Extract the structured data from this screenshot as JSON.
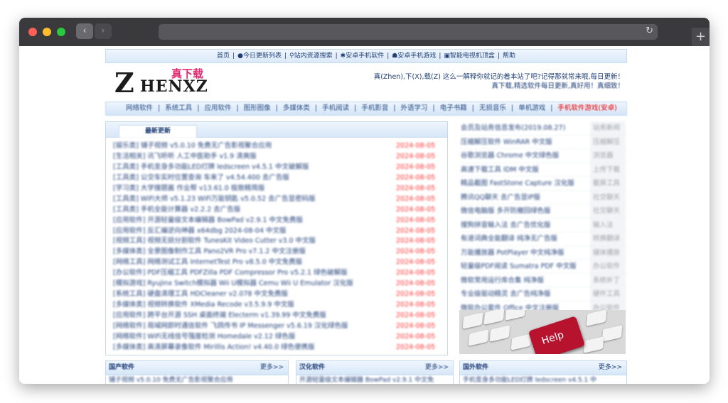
{
  "browser": {
    "back_icon": "chevron-left",
    "forward_icon": "chevron-right",
    "reload_icon": "reload",
    "new_tab_icon": "plus",
    "reload_glyph": "↻",
    "new_tab_glyph": "+",
    "back_glyph": "‹",
    "forward_glyph": "›"
  },
  "topnav": {
    "items": [
      "首页",
      "|",
      "●今日更新列表",
      "|",
      "⚲站内资源搜索",
      "|",
      "✱安卓手机软件",
      "|",
      "☗安卓手机游戏",
      "|",
      "▣智能电视机顶盒",
      "|",
      "帮助"
    ]
  },
  "logo": {
    "z": "Z",
    "rest": "HENXZ",
    "cn": "真下载"
  },
  "slogan": {
    "line1": "真(Zhen),下(X),载(Z) 这么一解释你就记的着本站了吧?记得那就常来哦,每日更新！",
    "line2": "真下载,精选软件每日更新,真好用！真细致！"
  },
  "catbar": {
    "items": [
      "网络软件",
      "|",
      "系统工具",
      "|",
      "应用软件",
      "|",
      "图形图像",
      "|",
      "多媒体类",
      "|",
      "手机阅读",
      "|",
      "手机影音",
      "|",
      "外语学习",
      "|",
      "电子书籍",
      "|",
      "无损音乐",
      "|",
      "单机游戏",
      "|"
    ],
    "highlight": "手机软件游戏(安卓)"
  },
  "updates": {
    "tab_label": "最新更新",
    "rows": [
      {
        "title": "[娱乐类] 铺子视频 v5.0.10 免费无广告影视聚合应用",
        "date": "2024-08-05"
      },
      {
        "title": "[生活相关] 讯飞听听 人工中医助手 v1.9 清爽版",
        "date": "2024-08-05"
      },
      {
        "title": "[工具类] 手机变身多功能LED灯牌 ledscreen v4.5.1 中文破解版",
        "date": "2024-08-05"
      },
      {
        "title": "[工具类] 公交车实时位置查询 车来了 v4.54.400 去广告版",
        "date": "2024-08-05"
      },
      {
        "title": "[学习类] 大学搜题酱 作业帮 v13.61.0 极致精简版",
        "date": "2024-08-05"
      },
      {
        "title": "[工具类] WiFi大师 v5.1.23 WiFi万能钥匙 v5.0.52 去广告显密码版",
        "date": "2024-08-05"
      },
      {
        "title": "[工具类] 手机全能计算器 v2.2.2 去广告版",
        "date": "2024-08-05"
      },
      {
        "title": "[应用软件] 开源轻量级文本编辑器 BowPad v2.9.1 中文免费版",
        "date": "2024-08-05"
      },
      {
        "title": "[应用软件] 反汇编逆向神器 x64dbg 2024-08-04 中文版",
        "date": "2024-08-05"
      },
      {
        "title": "[视频工具] 视频无损分割软件 TunesKit Video Cutter v3.0 中文版",
        "date": "2024-08-05"
      },
      {
        "title": "[多媒体类] 全景图像制作工具 Pano2VR Pro v7.1.2 中文注册版",
        "date": "2024-08-05"
      },
      {
        "title": "[网络工具] 网络测试工具 InternetTest Pro v8.5.0 中文免费版",
        "date": "2024-08-05"
      },
      {
        "title": "[办公软件] PDF压缩工具 PDFZilla PDF Compressor Pro v5.2.1 绿色破解版",
        "date": "2024-08-05"
      },
      {
        "title": "[模拟游戏] Ryujinx Switch模拟器 Wii U模拟器 Cemu Wii U Emulator 汉化版",
        "date": "2024-08-05"
      },
      {
        "title": "[系统工具] 硬盘清理工具 HDCleaner v2.078 中文免费版",
        "date": "2024-08-05"
      },
      {
        "title": "[多媒体类] 视频转换软件 XMedia Recode v3.5.9.9 中文版",
        "date": "2024-08-05"
      },
      {
        "title": "[应用软件] 跨平台开源 SSH 桌面终端 Electerm v1.39.99 中文免费版",
        "date": "2024-08-05"
      },
      {
        "title": "[网络软件] 局域网即时通信软件 飞鸽传书 IP Messenger v5.6.19 汉化绿色版",
        "date": "2024-08-05"
      },
      {
        "title": "[网络软件] WiFi无线信号强度检测 Homedale v2.12 绿色版",
        "date": "2024-08-05"
      },
      {
        "title": "[多媒体类] 高清屏幕录像软件 Mirillis Action! v4.40.0 绿色便携版",
        "date": "2024-08-05"
      }
    ]
  },
  "sidebar": {
    "rows": [
      {
        "title": "会员及站务信息发布(2019.08.27)",
        "cat": "站务新闻"
      },
      {
        "title": "压缩解压软件 WinRAR 中文版",
        "cat": "压缩解压"
      },
      {
        "title": "谷歌浏览器 Chrome 中文绿色版",
        "cat": "浏览器"
      },
      {
        "title": "高速下载工具 IDM 中文版",
        "cat": "上传下载"
      },
      {
        "title": "精品截图 FastStone Capture 汉化版",
        "cat": "截屏工具"
      },
      {
        "title": "腾讯QQ聊天 去广告显IP版",
        "cat": "社交聊天"
      },
      {
        "title": "微信电脑版 多开防撤回绿色版",
        "cat": "社交聊天"
      },
      {
        "title": "搜狗拼音输入法 去广告优化版",
        "cat": "输入法"
      },
      {
        "title": "有道词典全能翻译 纯净无广告版",
        "cat": "转换翻译"
      },
      {
        "title": "万能播放器 PotPlayer 中文纯净版",
        "cat": "媒体播放"
      },
      {
        "title": "轻量级PDF阅读 Sumatra PDF 中文版",
        "cat": "办公软件"
      },
      {
        "title": "微软常用运行库合集 纯净版",
        "cat": "系统补丁"
      },
      {
        "title": "专业级驱动精灵 去广告纯净版",
        "cat": "硬件工具"
      },
      {
        "title": "微软办公套件 Office 中文注册版",
        "cat": "办公软件"
      }
    ],
    "help_image_text": "Help"
  },
  "bottom_panels": [
    {
      "title": "国产软件",
      "more": "更多>>",
      "line": "铺子视频 v5.0.10 免费无广告影视聚合应用"
    },
    {
      "title": "汉化软件",
      "more": "更多>>",
      "line": "开源轻量级文本编辑器 BowPad v2.9.1 中文免"
    },
    {
      "title": "国外软件",
      "more": "更多>>",
      "line": "手机变身多功能LED灯牌 ledscreen v4.5.1 中"
    }
  ]
}
